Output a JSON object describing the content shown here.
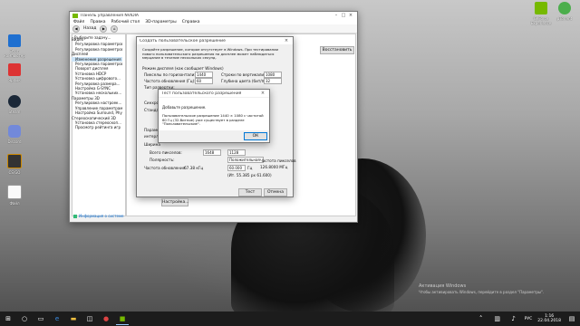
{
  "desktop": {
    "left_icons": [
      {
        "label": "Этот компьютер",
        "icon": "computer-icon"
      },
      {
        "label": "Ярлык",
        "icon": "shortcut-icon"
      },
      {
        "label": "Steam",
        "icon": "steam-icon"
      },
      {
        "label": "Discord",
        "icon": "discord-icon"
      },
      {
        "label": "CS:GO",
        "icon": "csgo-icon"
      },
      {
        "label": "Файл",
        "icon": "file-icon"
      }
    ],
    "right_icons": [
      {
        "label": "GeForce Experience",
        "icon": "geforce-icon"
      },
      {
        "label": "µTorrent",
        "icon": "utorrent-icon"
      }
    ],
    "watermark_line1": "Активация Windows",
    "watermark_line2": "Чтобы активировать Windows, перейдите в раздел \"Параметры\"."
  },
  "nvcp": {
    "title": "Панель управления NVIDIA",
    "menu": [
      "Файл",
      "Правка",
      "Рабочий стол",
      "3D-параметры",
      "Справка"
    ],
    "toolbar_back": "Назад",
    "select_task": "Выберите задачу...",
    "tree": [
      "Видео",
      "Регулировка параметров...",
      "Регулировка параметров...",
      "Дисплей",
      "Изменение разрешения",
      "Регулировка параметров...",
      "Поворот дисплея",
      "Установка HDCP",
      "Установка цифрового...",
      "Регулировка размера...",
      "Настройка G-SYNC",
      "Установка нескольких...",
      "Параметры 3D",
      "Регулировка настроек...",
      "Управление параметрами 3D",
      "Настройка Surround, PhysX",
      "Стереоскопический 3D",
      "Установка стереоскоп...",
      "Просмотр рейтинга игр"
    ],
    "restore_button": "Восстановить",
    "system_info": "Информация о системе"
  },
  "custom_dialog": {
    "title": "Создать пользовательское разрешение",
    "intro": "Создайте разрешение, которое отсутствует в Windows. При тестировании нового пользовательского разрешения на дисплее может наблюдаться мерцание в течение нескольких секунд.",
    "display_mode_label": "Режим дисплея (как сообщает Windows)",
    "hpixels_label": "Пикселы по горизонтали:",
    "hpixels_value": "1440",
    "vlines_label": "Строки по вертикали:",
    "vlines_value": "1080",
    "refresh_label": "Частота обновления (Гц):",
    "refresh_value": "60",
    "depth_label": "Глубина цвета (бит/пкс):",
    "depth_value": "32",
    "scan_label": "Тип развертки:",
    "sync_label": "Синхро",
    "standard_label": "Стандарт",
    "params_label": "Параметры",
    "interlace_label": "интерлейс",
    "width_label": "Ширина",
    "total_pixels_label": "Всего пикселов:",
    "total_pixels_value": "1648",
    "total_lines_value": "1128",
    "polarity_label": "Полярность:",
    "polarity_value": "Положительная",
    "refresh2_label": "Частота обновления:",
    "refresh2_value": "67.38 кГц",
    "refresh2_hz": "60.000",
    "hz_unit": "Гц",
    "pixel_freq_label": "Частота пикселов",
    "pixel_freq_value": "126.8000 МГц",
    "total_px_label": "(Ит. 55.385 px 61.600)",
    "test_button": "Тест",
    "cancel_button": "Отмена",
    "customize_button": "Настройка..."
  },
  "test_dialog": {
    "title": "Тест пользовательского разрешения",
    "heading": "Добавьте разрешение.",
    "message": "Пользовательское разрешение 1440 × 1080 с частотой 60 Гц (32-битное) уже существует в разделе \"Пользовательские\".",
    "ok_button": "ОК"
  },
  "taskbar": {
    "lang": "РУС",
    "time": "1:16",
    "date": "22.04.2018"
  }
}
